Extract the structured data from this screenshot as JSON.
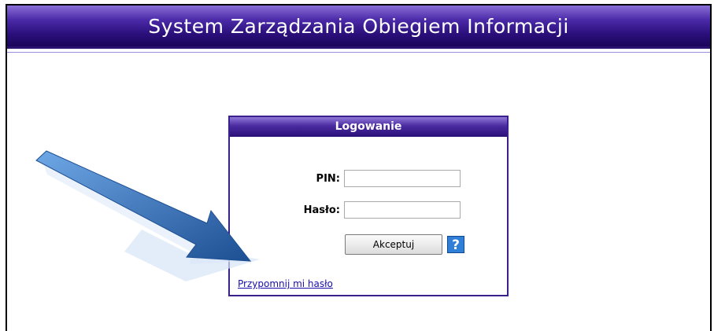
{
  "header": {
    "title": "System Zarządzania Obiegiem Informacji"
  },
  "login": {
    "title": "Logowanie",
    "pin_label": "PIN:",
    "pin_value": "",
    "password_label": "Hasło:",
    "password_value": "",
    "accept_label": "Akceptuj",
    "help_label": "?",
    "remind_label": "Przypomnij mi hasło"
  },
  "colors": {
    "header_dark": "#2a0f7a",
    "header_light": "#8a6fd6",
    "link": "#1a0dab",
    "help": "#2f7fd8",
    "arrow": "#2b6bb8"
  },
  "icons": {
    "annotation": "arrow-icon"
  }
}
